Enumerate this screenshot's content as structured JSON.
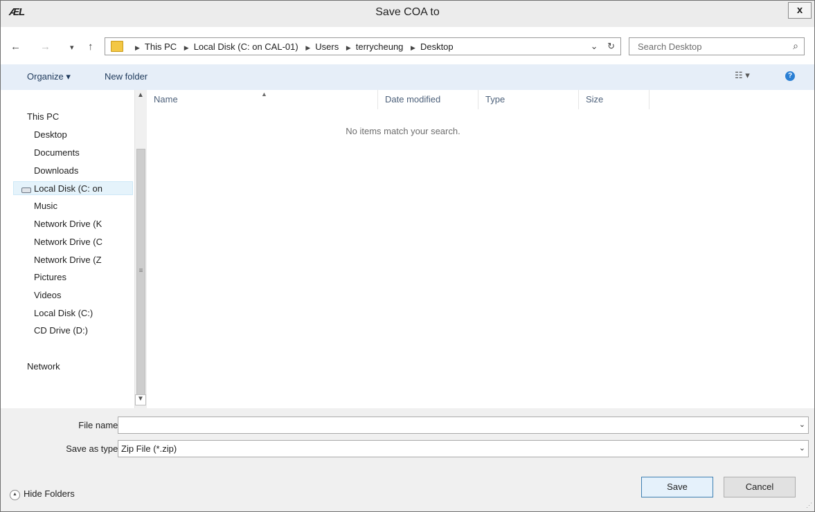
{
  "window": {
    "title": "Save COA to",
    "app_icon": "ÆL",
    "close_label": "x"
  },
  "navbar": {
    "back_glyph": "←",
    "forward_glyph": "→",
    "recent_glyph": "▾",
    "up_glyph": "↑",
    "breadcrumbs": [
      "This PC",
      "Local Disk (C: on CAL-01)",
      "Users",
      "terrycheung",
      "Desktop"
    ],
    "address_dropdown_glyph": "⌄",
    "refresh_glyph": "↻",
    "search_placeholder": "Search Desktop",
    "search_glyph": "⌕"
  },
  "commands": {
    "organize": "Organize ▾",
    "new_folder": "New folder",
    "view_glyph": "☷ ▾",
    "help_glyph": "?"
  },
  "sidebar": {
    "items": [
      {
        "label": "This PC",
        "icon": "computer-icon"
      },
      {
        "label": "Desktop",
        "icon": "desktop-folder-icon"
      },
      {
        "label": "Documents",
        "icon": "documents-folder-icon"
      },
      {
        "label": "Downloads",
        "icon": "downloads-folder-icon"
      },
      {
        "label": "Local Disk (C: on",
        "icon": "drive-icon"
      },
      {
        "label": "Music",
        "icon": "music-folder-icon"
      },
      {
        "label": "Network Drive (K",
        "icon": "network-drive-icon"
      },
      {
        "label": "Network Drive (C",
        "icon": "network-drive-icon"
      },
      {
        "label": "Network Drive (Z",
        "icon": "network-drive-icon"
      },
      {
        "label": "Pictures",
        "icon": "pictures-folder-icon"
      },
      {
        "label": "Videos",
        "icon": "videos-folder-icon"
      },
      {
        "label": "Local Disk (C:)",
        "icon": "drive-icon"
      },
      {
        "label": "CD Drive (D:)",
        "icon": "cd-drive-icon"
      },
      {
        "label": "Network",
        "icon": "network-icon"
      }
    ],
    "selected_index": 4
  },
  "file_list": {
    "columns": [
      "Name",
      "Date modified",
      "Type",
      "Size"
    ],
    "sorted_column": "Name",
    "empty_message": "No items match your search."
  },
  "form": {
    "file_name_label": "File name:",
    "file_name_value": "",
    "save_type_label": "Save as type:",
    "save_type_value": "Zip File (*.zip)",
    "dropdown_glyph": "⌄"
  },
  "footer": {
    "hide_folders_label": "Hide Folders",
    "hide_folders_glyph": "▲",
    "save_label": "Save",
    "cancel_label": "Cancel"
  }
}
